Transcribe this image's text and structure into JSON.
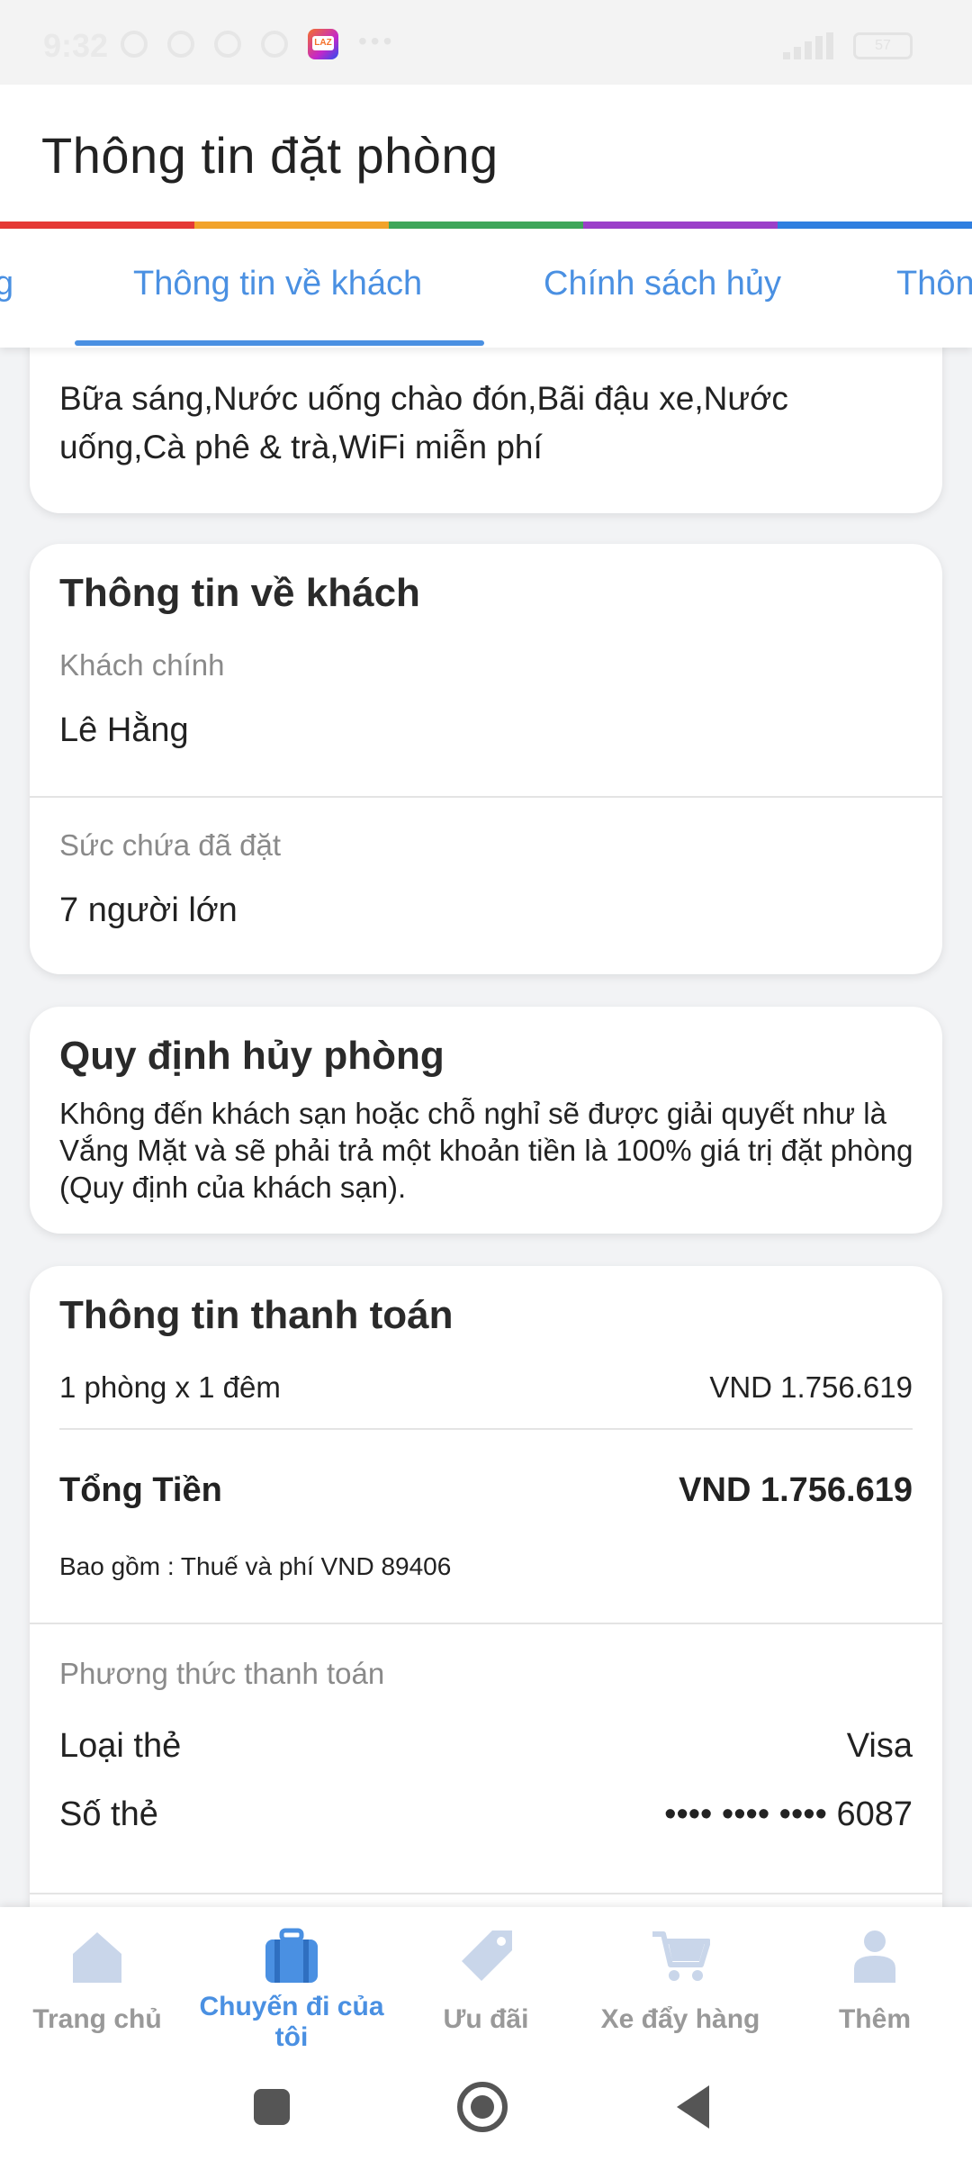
{
  "status_bar": {
    "time": "9:32",
    "battery": "57"
  },
  "header": {
    "title": "Thông tin đặt phòng"
  },
  "accent_colors": [
    "#e53935",
    "#f2a32b",
    "#3fa65a",
    "#9b3fc9",
    "#2f7fe0"
  ],
  "tabs": [
    {
      "label": "g"
    },
    {
      "label": "Thông tin về khách",
      "active": true
    },
    {
      "label": "Chính sách hủy"
    },
    {
      "label": "Thôn"
    }
  ],
  "amenities": {
    "text": "Bữa sáng,Nước uống chào đón,Bãi đậu xe,Nước uống,Cà phê & trà,WiFi miễn phí"
  },
  "guest_info": {
    "title": "Thông tin về khách",
    "main_guest_label": "Khách chính",
    "main_guest_value": "Lê Hằng",
    "capacity_label": "Sức chứa đã đặt",
    "capacity_value": "7 người lớn"
  },
  "cancel_policy": {
    "title": "Quy định hủy phòng",
    "text": "Không đến khách sạn hoặc chỗ nghỉ sẽ được giải quyết như là Vắng Mặt và sẽ phải trả một khoản tiền là 100% giá trị đặt phòng (Quy định của khách sạn)."
  },
  "payment": {
    "title": "Thông tin thanh toán",
    "room_line_label": "1 phòng x 1 đêm",
    "room_line_value": "VND 1.756.619",
    "total_label": "Tổng Tiền",
    "total_value": "VND 1.756.619",
    "includes": "Bao gồm : Thuế và phí VND 89406",
    "method_label": "Phương thức thanh toán",
    "card_type_label": "Loại thẻ",
    "card_type_value": "Visa",
    "card_number_label": "Số thẻ",
    "card_number_value": "•••• •••• •••• 6087"
  },
  "bottom_nav": [
    {
      "label": "Trang chủ",
      "icon": "home-icon"
    },
    {
      "label": "Chuyến đi của tôi",
      "icon": "suitcase-icon",
      "active": true
    },
    {
      "label": "Ưu đãi",
      "icon": "tag-icon"
    },
    {
      "label": "Xe đẩy hàng",
      "icon": "cart-icon"
    },
    {
      "label": "Thêm",
      "icon": "person-icon"
    }
  ]
}
